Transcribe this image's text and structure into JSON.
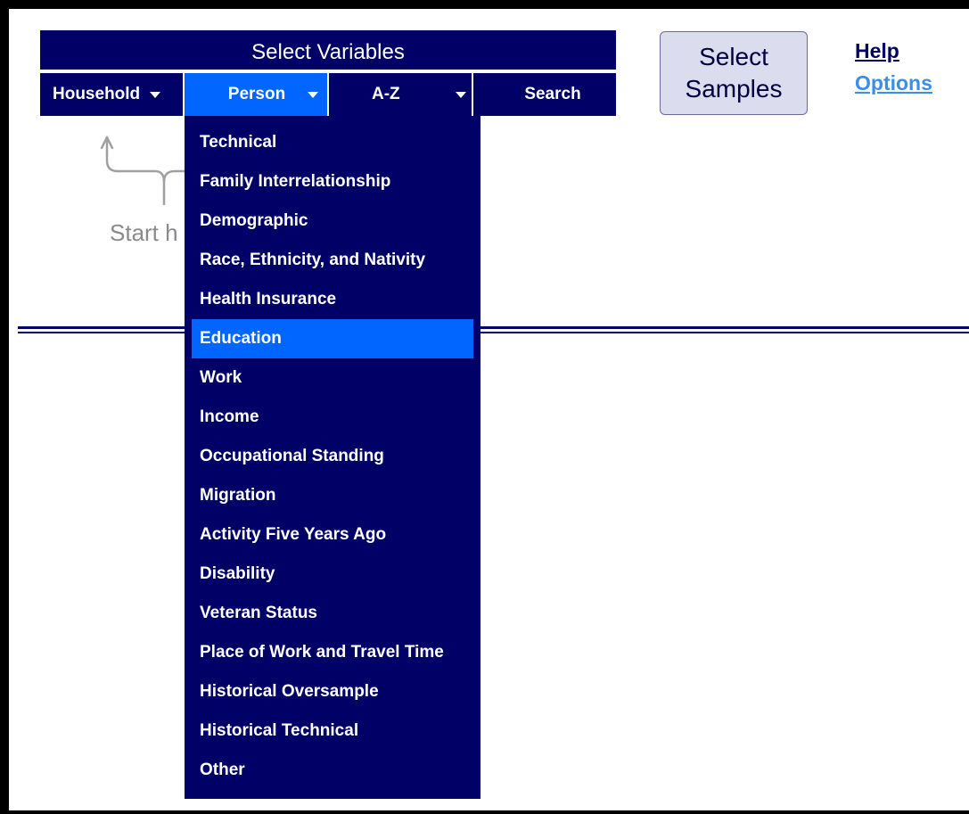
{
  "variables_panel": {
    "title": "Select Variables",
    "tabs": [
      {
        "label": "Household",
        "has_dropdown": true
      },
      {
        "label": "Person",
        "has_dropdown": true,
        "active": true
      },
      {
        "label": "A-Z",
        "has_dropdown": true
      },
      {
        "label": "Search",
        "has_dropdown": false
      }
    ]
  },
  "select_samples": {
    "line1": "Select",
    "line2": "Samples"
  },
  "links": {
    "help": "Help",
    "options": "Options"
  },
  "hint": {
    "text": "Start h"
  },
  "person_menu": {
    "selected": "Education",
    "items": [
      "Technical",
      "Family Interrelationship",
      "Demographic",
      "Race, Ethnicity, and Nativity",
      "Health Insurance",
      "Education",
      "Work",
      "Income",
      "Occupational Standing",
      "Migration",
      "Activity Five Years Ago",
      "Disability",
      "Veteran Status",
      "Place of Work and Travel Time",
      "Historical Oversample",
      "Historical Technical",
      "Other"
    ]
  },
  "colors": {
    "navy": "#000066",
    "active_blue": "#0066ff",
    "button_bg": "#dcdcef",
    "link_dark": "#000060",
    "link_light": "#3a8ee6",
    "hint_gray": "#8a8a8a"
  }
}
